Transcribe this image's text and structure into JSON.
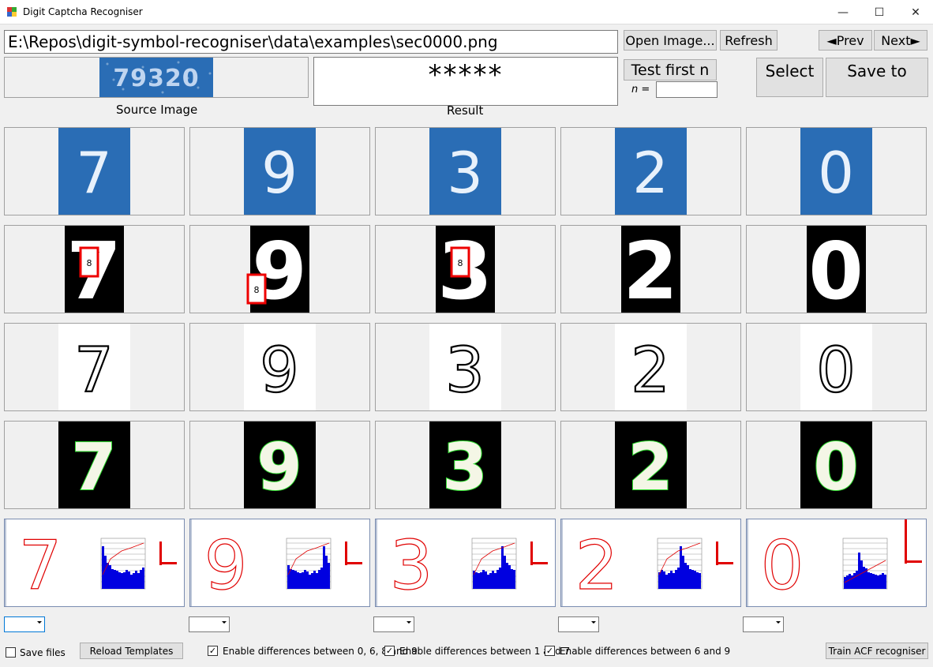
{
  "window": {
    "title": "Digit Captcha Recogniser",
    "minimize_glyph": "—",
    "maximize_glyph": "☐",
    "close_glyph": "✕"
  },
  "toolbar": {
    "path_value": "E:\\Repos\\digit-symbol-recogniser\\data\\examples\\sec0000.png",
    "open_image_label": "Open Image...",
    "refresh_label": "Refresh",
    "prev_label": "◄Prev",
    "next_label": "Next►",
    "test_first_n_label": "Test first n",
    "n_label": "n =",
    "n_value": "",
    "select_label": "Select",
    "save_to_label": "Save to"
  },
  "source": {
    "caption": "Source Image",
    "captcha_text": "79320",
    "bg_color": "#2a6db5"
  },
  "result": {
    "caption": "Result",
    "value": "*****"
  },
  "digits": [
    "7",
    "9",
    "3",
    "2",
    "0"
  ],
  "overlay_label": "8",
  "colors": {
    "digit_blue": "#2a6db5",
    "contour_red": "#e00000",
    "outline_green": "#2cdc2c",
    "hist_blue": "#0000e0"
  },
  "bottom": {
    "save_files_label": "Save files",
    "save_files_checked": false,
    "reload_templates_label": "Reload Templates",
    "diff_0689_label": "Enable differences between 0, 6, 8 and 9",
    "diff_0689_checked": true,
    "diff_17_label": "Enable differences between 1 and 7",
    "diff_17_checked": true,
    "diff_69_label": "Enable differences between 6 and 9",
    "diff_69_checked": true,
    "train_acf_label": "Train ACF recogniser",
    "check_glyph": "✓"
  }
}
